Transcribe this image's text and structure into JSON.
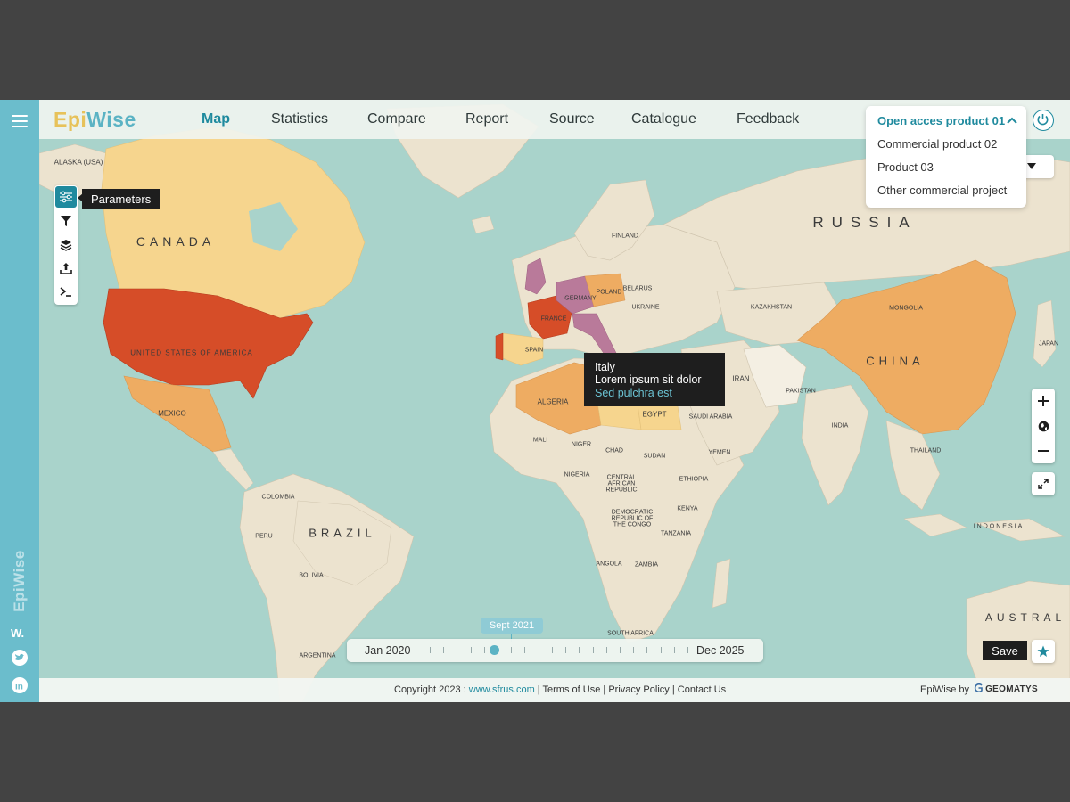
{
  "brand": {
    "part1": "Epi",
    "part2": "Wise",
    "rail_text": "EpiWise"
  },
  "nav": {
    "items": [
      "Map",
      "Statistics",
      "Compare",
      "Report",
      "Source",
      "Catalogue",
      "Feedback"
    ],
    "active": "Map"
  },
  "product_menu": {
    "selected": "Open acces product 01",
    "options": [
      "Commercial product 02",
      "Product 03",
      "Other commercial project"
    ]
  },
  "tools": {
    "tooltip": "Parameters",
    "items": [
      "parameters",
      "filter",
      "layers",
      "upload",
      "console"
    ]
  },
  "map": {
    "big_labels": [
      "CANADA",
      "RUSSIA",
      "CHINA",
      "BRAZIL",
      "AUSTRAL"
    ],
    "country_labels": [
      "ALASKA (USA)",
      "UNITED STATES OF AMERICA",
      "MEXICO",
      "COLOMBIA",
      "PERU",
      "BOLIVIA",
      "ARGENTINA",
      "ALGERIA",
      "EGYPT",
      "MALI",
      "NIGER",
      "CHAD",
      "SUDAN",
      "NIGERIA",
      "ETHIOPIA",
      "KENYA",
      "ANGOLA",
      "ZAMBIA",
      "TANZANIA",
      "SAUDI ARABIA",
      "IRAN",
      "KAZAKHSTAN",
      "MONGOLIA",
      "INDIA",
      "INDONESIA",
      "JAPAN",
      "UKRAINE",
      "POLAND",
      "GERMANY",
      "FRANCE",
      "SPAIN",
      "FINLAND",
      "BELARUS",
      "YEMEN",
      "PAKISTAN",
      "THAILAND",
      "SOUTH AFRICA",
      "DEMOCRATIC REPUBLIC OF THE CONGO",
      "CENTRAL AFRICAN REPUBLIC"
    ],
    "colors": {
      "ocean": "#a9d3cb",
      "land": "#ece3cf",
      "light": "#f6d58e",
      "medium": "#eeac62",
      "high": "#d64d28",
      "purple": "#b97a9a"
    }
  },
  "country_tooltip": {
    "title": "Italy",
    "line2": "Lorem ipsum sit dolor",
    "line3": "Sed pulchra est"
  },
  "timeline": {
    "start": "Jan 2020",
    "end": "Dec 2025",
    "current": "Sept 2021",
    "position": 0.25
  },
  "save": {
    "label": "Save"
  },
  "footer": {
    "copyright": "Copyright 2023 : ",
    "site": "www.sfrus.com",
    "links": [
      "Terms of Use",
      "Privacy Policy",
      "Contact Us"
    ],
    "by": "EpiWise by",
    "partner": "GEOMATYS"
  }
}
